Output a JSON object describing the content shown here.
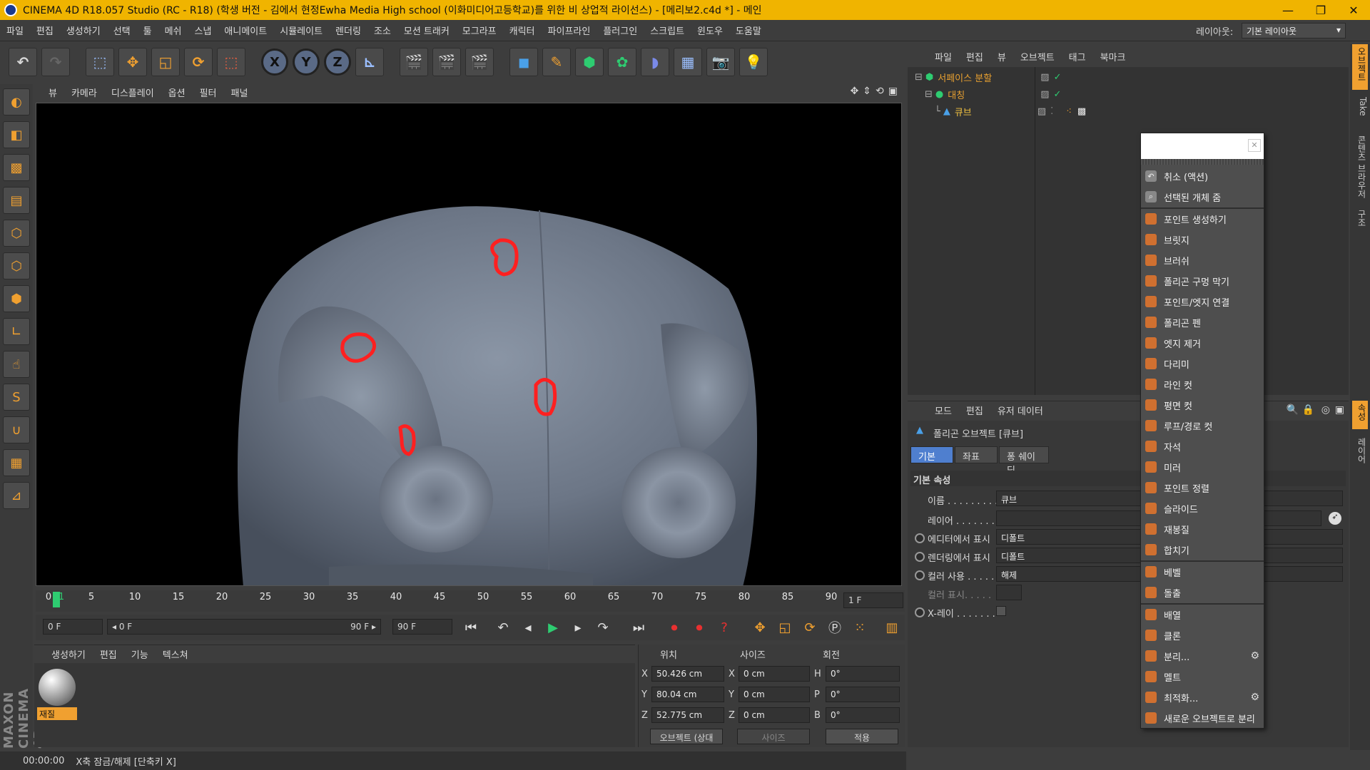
{
  "window": {
    "title": "CINEMA 4D R18.057 Studio (RC - R18) (학생 버전 - 김에서 현정Ewha Media High school (이화미디어고등학교)를 위한 비 상업적 라이선스) - [메리보2.c4d *] - 메인",
    "buttons": [
      "—",
      "❐",
      "✕"
    ]
  },
  "menubar": {
    "items": [
      "파일",
      "편집",
      "생성하기",
      "선택",
      "툴",
      "메쉬",
      "스냅",
      "애니메이트",
      "시뮬레이트",
      "렌더링",
      "조소",
      "모션 트래커",
      "모그라프",
      "캐릭터",
      "파이프라인",
      "플러그인",
      "스크립트",
      "윈도우",
      "도움말"
    ],
    "layout_label": "레이아웃:",
    "layout_value": "기본 레이아웃"
  },
  "viewport": {
    "menu": [
      "뷰",
      "카메라",
      "디스플레이",
      "옵션",
      "필터",
      "패널"
    ]
  },
  "timeline": {
    "ticks": [
      "0",
      "5",
      "10",
      "15",
      "20",
      "25",
      "30",
      "35",
      "40",
      "45",
      "50",
      "55",
      "60",
      "65",
      "70",
      "75",
      "80",
      "85",
      "90"
    ],
    "current_frame_marker": "1",
    "frame_field": "1 F"
  },
  "transport": {
    "start_field": "0 F",
    "range_start": "◂ 0 F",
    "range_end": "90 F ▸",
    "end_field": "90 F"
  },
  "material_manager": {
    "menu": [
      "생성하기",
      "편집",
      "기능",
      "텍스쳐"
    ],
    "material_name": "재질"
  },
  "coordinates": {
    "headers": [
      "위치",
      "사이즈",
      "회전"
    ],
    "position": [
      {
        "axis": "X",
        "value": "50.426 cm"
      },
      {
        "axis": "Y",
        "value": "80.04 cm"
      },
      {
        "axis": "Z",
        "value": "52.775 cm"
      }
    ],
    "size": [
      {
        "axis": "X",
        "value": "0 cm"
      },
      {
        "axis": "Y",
        "value": "0 cm"
      },
      {
        "axis": "Z",
        "value": "0 cm"
      }
    ],
    "rotation": [
      {
        "axis": "H",
        "value": "0°"
      },
      {
        "axis": "P",
        "value": "0°"
      },
      {
        "axis": "B",
        "value": "0°"
      }
    ],
    "mode_select": "오브젝트 (상대",
    "size_select": "사이즈",
    "apply_button": "적용"
  },
  "statusbar": {
    "time": "00:00:00",
    "message": "X축 잠금/해제 [단축키 X]"
  },
  "object_manager": {
    "menu": [
      "파일",
      "편집",
      "뷰",
      "오브젝트",
      "태그",
      "북마크"
    ],
    "objects": [
      {
        "name": "서페이스 분할",
        "color": "#e8a030"
      },
      {
        "name": "대칭",
        "color": "#e8a030"
      },
      {
        "name": "큐브",
        "color": "#f0c040"
      }
    ]
  },
  "attribute_manager": {
    "menu": [
      "모드",
      "편집",
      "유저 데이터"
    ],
    "title": "폴리곤 오브젝트 [큐브]",
    "tabs": [
      "기본",
      "좌표",
      "퐁 쉐이딩"
    ],
    "section": "기본 속성",
    "fields": [
      {
        "label": "이름 . . . . . . . . .",
        "value": "큐브"
      },
      {
        "label": "레이어 . . . . . . . .",
        "value": ""
      },
      {
        "label": "에디터에서 표시",
        "value": "디폴트"
      },
      {
        "label": "렌더링에서 표시",
        "value": "디폴트"
      },
      {
        "label": "컬러 사용 . . . . .",
        "value": "해제"
      },
      {
        "label": "컬러 표시. . . . .",
        "value": ""
      },
      {
        "label": "X-레이 . . . . . . .",
        "value": ""
      }
    ]
  },
  "right_tabs": [
    "오브젝트",
    "Take",
    "콘텐츠 브라우저",
    "구조",
    "속성",
    "레이어"
  ],
  "context_menu": {
    "items": [
      {
        "label": "취소 (액션)",
        "icon": "undo-icon",
        "color": "#888"
      },
      {
        "label": "선택된 개체 줌",
        "icon": "zoom-icon",
        "color": "#888"
      },
      {
        "label": "포인트 생성하기",
        "icon": "point-icon",
        "color": "#d07030"
      },
      {
        "label": "브릿지",
        "icon": "bridge-icon",
        "color": "#d07030"
      },
      {
        "label": "브러쉬",
        "icon": "brush-icon",
        "color": "#d07030"
      },
      {
        "label": "폴리곤 구멍 막기",
        "icon": "close-hole-icon",
        "color": "#d07030"
      },
      {
        "label": "포인트/엣지 연결",
        "icon": "connect-icon",
        "color": "#d07030"
      },
      {
        "label": "폴리곤 펜",
        "icon": "polygon-pen-icon",
        "color": "#d07030"
      },
      {
        "label": "엣지 제거",
        "icon": "dissolve-icon",
        "color": "#d07030"
      },
      {
        "label": "다리미",
        "icon": "iron-icon",
        "color": "#d07030"
      },
      {
        "label": "라인 컷",
        "icon": "line-cut-icon",
        "color": "#d07030"
      },
      {
        "label": "평면 컷",
        "icon": "plane-cut-icon",
        "color": "#d07030"
      },
      {
        "label": "루프/경로 컷",
        "icon": "loop-cut-icon",
        "color": "#d07030"
      },
      {
        "label": "자석",
        "icon": "magnet-icon",
        "color": "#d07030"
      },
      {
        "label": "미러",
        "icon": "mirror-icon",
        "color": "#d07030"
      },
      {
        "label": "포인트 정렬",
        "icon": "set-point-icon",
        "color": "#d07030"
      },
      {
        "label": "슬라이드",
        "icon": "slide-icon",
        "color": "#d07030"
      },
      {
        "label": "재봉질",
        "icon": "stitch-icon",
        "color": "#d07030"
      },
      {
        "label": "합치기",
        "icon": "weld-icon",
        "color": "#d07030"
      },
      {
        "label": "베벨",
        "icon": "bevel-icon",
        "color": "#d07030"
      },
      {
        "label": "돌출",
        "icon": "extrude-icon",
        "color": "#d07030"
      },
      {
        "label": "배열",
        "icon": "array-icon",
        "color": "#d07030"
      },
      {
        "label": "클론",
        "icon": "clone-icon",
        "color": "#d07030"
      },
      {
        "label": "분리...",
        "icon": "disconnect-icon",
        "color": "#d07030",
        "gear": true
      },
      {
        "label": "멜트",
        "icon": "melt-icon",
        "color": "#d07030"
      },
      {
        "label": "최적화...",
        "icon": "optimize-icon",
        "color": "#d07030",
        "gear": true
      },
      {
        "label": "새로운 오브젝트로 분리",
        "icon": "split-icon",
        "color": "#d07030"
      }
    ]
  },
  "brand": "MAXON CINEMA 4D"
}
